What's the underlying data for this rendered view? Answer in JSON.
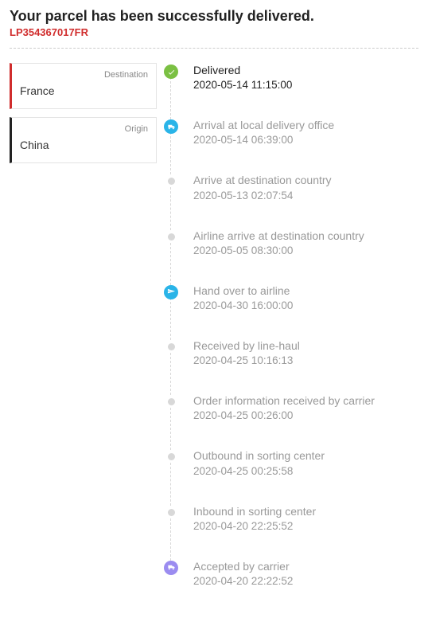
{
  "header": {
    "title": "Your parcel has been successfully delivered.",
    "tracking_id": "LP354367017FR"
  },
  "locations": {
    "destination_label": "Destination",
    "destination_value": "France",
    "origin_label": "Origin",
    "origin_value": "China"
  },
  "timeline": [
    {
      "status": "Delivered",
      "date": "2020-05-14 11:15:00",
      "icon": "check",
      "current": true
    },
    {
      "status": "Arrival at local delivery office",
      "date": "2020-05-14 06:39:00",
      "icon": "truck-blue"
    },
    {
      "status": "Arrive at destination country",
      "date": "2020-05-13 02:07:54",
      "icon": "dot"
    },
    {
      "status": "Airline arrive at destination country",
      "date": "2020-05-05 08:30:00",
      "icon": "dot"
    },
    {
      "status": "Hand over to airline",
      "date": "2020-04-30 16:00:00",
      "icon": "plane"
    },
    {
      "status": "Received by line-haul",
      "date": "2020-04-25 10:16:13",
      "icon": "dot"
    },
    {
      "status": "Order information received by carrier",
      "date": "2020-04-25 00:26:00",
      "icon": "dot"
    },
    {
      "status": "Outbound in sorting center",
      "date": "2020-04-25 00:25:58",
      "icon": "dot"
    },
    {
      "status": "Inbound in sorting center",
      "date": "2020-04-20 22:25:52",
      "icon": "dot"
    },
    {
      "status": "Accepted by carrier",
      "date": "2020-04-20 22:22:52",
      "icon": "truck-purple"
    }
  ]
}
